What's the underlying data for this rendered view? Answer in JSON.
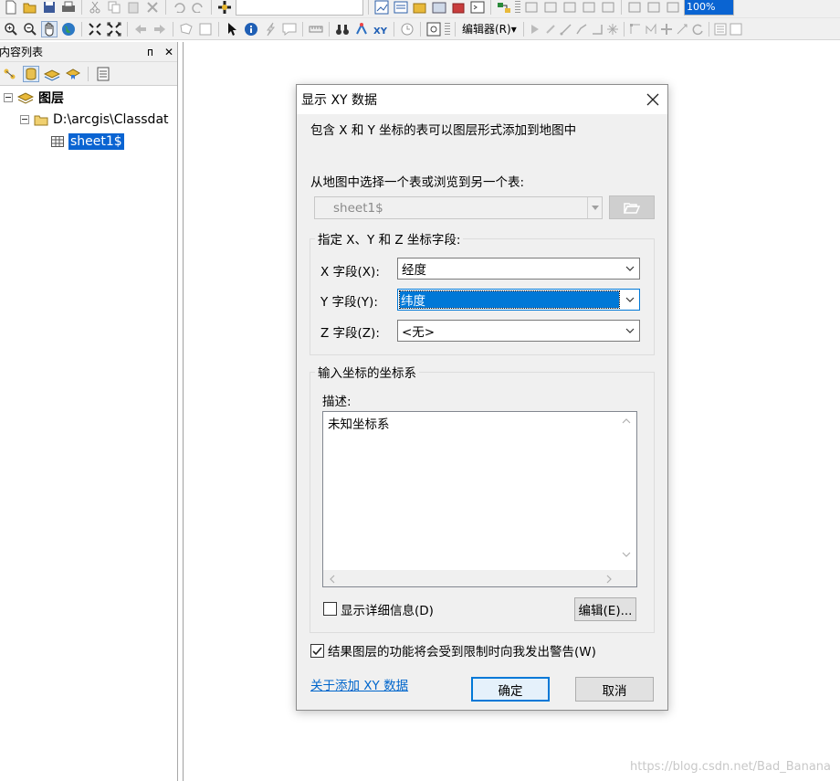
{
  "toolbar": {
    "editor_label": "编辑器(R)▾",
    "zoom_value": "100%"
  },
  "toc": {
    "title": "内容列表",
    "pin": "ᴨ",
    "close": "✕",
    "root_label": "图层",
    "folder_label": "D:\\arcgis\\Classdat",
    "table_label": "sheet1$"
  },
  "dialog": {
    "title": "显示 XY 数据",
    "intro": "包含 X 和 Y 坐标的表可以图层形式添加到地图中",
    "choose_label": "从地图中选择一个表或浏览到另一个表:",
    "table_value": "sheet1$",
    "fields_group": "指定 X、Y 和 Z 坐标字段:",
    "x_label": "X 字段(X):",
    "x_value": "经度",
    "y_label": "Y 字段(Y):",
    "y_value": "纬度",
    "z_label": "Z 字段(Z):",
    "z_value": "<无>",
    "crs_group": "输入坐标的坐标系",
    "desc_label": "描述:",
    "desc_value": "未知坐标系",
    "show_details_label": "显示详细信息(D)",
    "edit_button": "编辑(E)...",
    "warn_label": "结果图层的功能将会受到限制时向我发出警告(W)",
    "about_link": "关于添加 XY 数据",
    "ok_button": "确定",
    "cancel_button": "取消"
  },
  "watermark": "https://blog.csdn.net/Bad_Banana",
  "colors": {
    "selection": "#0a64d2",
    "default_button_border": "#0078d7",
    "link": "#0066cc"
  }
}
